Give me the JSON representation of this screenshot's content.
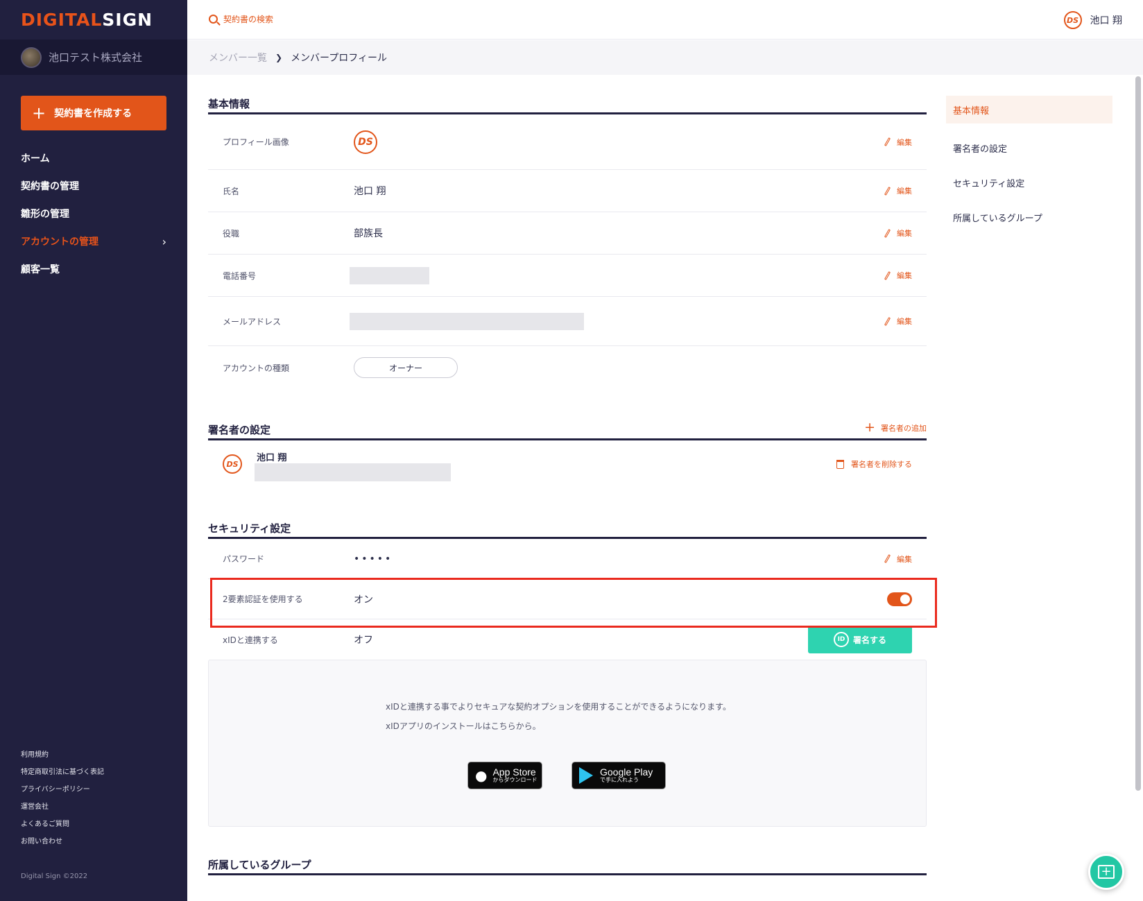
{
  "app": {
    "logo_part1": "DIGITAL",
    "logo_part2": "SIGN",
    "company_name": "池口テスト株式会社"
  },
  "sidebar": {
    "create_button": "契約書を作成する",
    "items": [
      {
        "label": "ホーム"
      },
      {
        "label": "契約書の管理"
      },
      {
        "label": "雛形の管理"
      },
      {
        "label": "アカウントの管理",
        "active": true
      },
      {
        "label": "顧客一覧"
      }
    ],
    "footer_links": [
      "利用規約",
      "特定商取引法に基づく表記",
      "プライバシーポリシー",
      "運営会社",
      "よくあるご質問",
      "お問い合わせ"
    ],
    "copyright": "Digital Sign ©2022"
  },
  "header": {
    "search_label": "契約書の検索",
    "user_initials": "DS",
    "user_name": "池口 翔"
  },
  "breadcrumb": {
    "parent": "メンバー一覧",
    "current": "メンバープロフィール"
  },
  "basic_info": {
    "title": "基本情報",
    "edit_label": "編集",
    "rows": {
      "profile_image_label": "プロフィール画像",
      "name_label": "氏名",
      "name_value": "池口 翔",
      "role_label": "役職",
      "role_value": "部族長",
      "phone_label": "電話番号",
      "email_label": "メールアドレス",
      "account_type_label": "アカウントの種類",
      "account_type_value": "オーナー"
    }
  },
  "signer_settings": {
    "title": "署名者の設定",
    "add_label": "署名者の追加",
    "signer_name": "池口 翔",
    "delete_label": "署名者を削除する"
  },
  "security": {
    "title": "セキュリティ設定",
    "password_label": "パスワード",
    "password_value": "•••••",
    "two_factor_label": "2要素認証を使用する",
    "two_factor_value": "オン",
    "two_factor_on": true,
    "xid_label": "xIDと連携する",
    "xid_value": "オフ",
    "xid_button": "署名する",
    "xid_icon_text": "ID",
    "xid_info_1": "xIDと連携する事でよりセキュアな契約オプションを使用することができるようになります。",
    "xid_info_2": "xIDアプリのインストールはこちらから。",
    "app_store_big": "App Store",
    "app_store_small": "からダウンロード",
    "google_play_big": "Google Play",
    "google_play_small": "で手に入れよう"
  },
  "groups": {
    "title": "所属しているグループ"
  },
  "right_nav": {
    "items": [
      "基本情報",
      "署名者の設定",
      "セキュリティ設定",
      "所属しているグループ"
    ]
  },
  "colors": {
    "accent": "#e2551a",
    "sidebar_bg": "#21203f",
    "xid_green": "#2ed3b0",
    "highlight_red": "#ea2a1e"
  }
}
